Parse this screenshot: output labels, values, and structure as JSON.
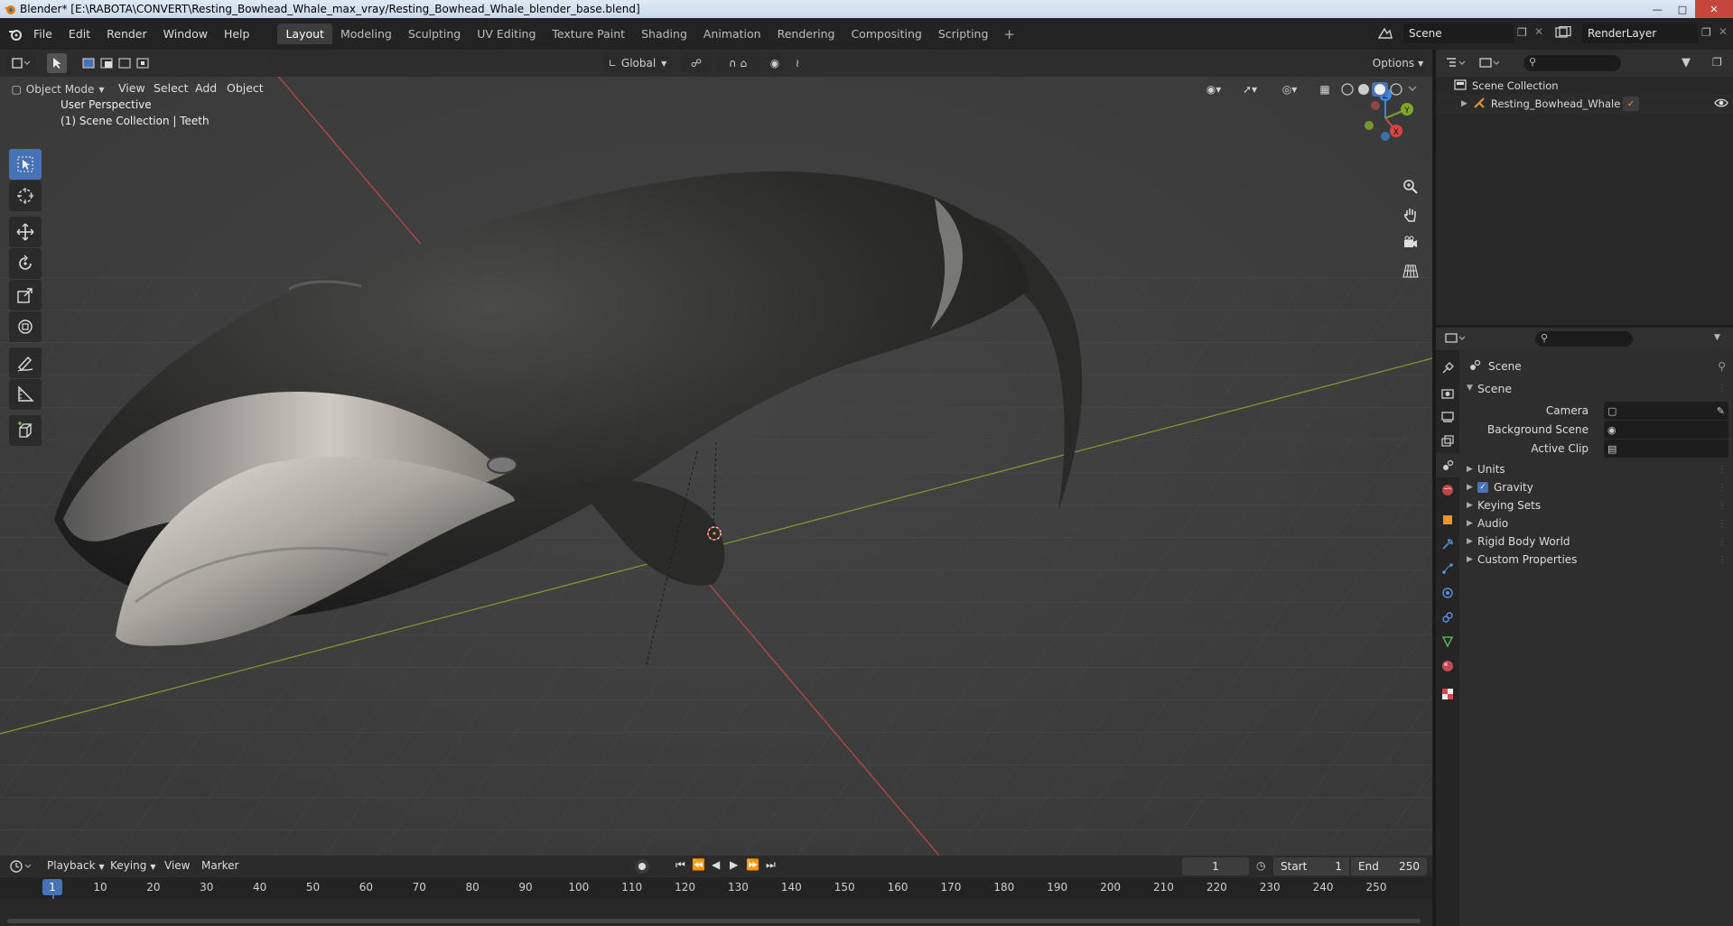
{
  "window": {
    "title": "Blender* [E:\\RABOTA\\CONVERT\\Resting_Bowhead_Whale_max_vray/Resting_Bowhead_Whale_blender_base.blend]"
  },
  "menu": [
    "File",
    "Edit",
    "Render",
    "Window",
    "Help"
  ],
  "workspaces": {
    "active": "Layout",
    "tabs": [
      "Layout",
      "Modeling",
      "Sculpting",
      "UV Editing",
      "Texture Paint",
      "Shading",
      "Animation",
      "Rendering",
      "Compositing",
      "Scripting"
    ],
    "add": "+"
  },
  "scene_selector": {
    "scene": "Scene",
    "view_layer": "RenderLayer"
  },
  "viewport": {
    "mode": "Object Mode",
    "menus": [
      "View",
      "Select",
      "Add",
      "Object"
    ],
    "transform_orientation": "Global",
    "options_label": "Options",
    "info_line1": "User Perspective",
    "info_line2": "(1) Scene Collection | Teeth",
    "gizmo": {
      "x": "X",
      "y": "Y",
      "z": "Z"
    }
  },
  "outliner": {
    "root": "Scene Collection",
    "items": [
      {
        "label": "Resting_Bowhead_Whale"
      }
    ]
  },
  "properties": {
    "context": "Scene",
    "panel_title": "Scene",
    "fields": [
      {
        "label": "Camera",
        "value": ""
      },
      {
        "label": "Background Scene",
        "value": ""
      },
      {
        "label": "Active Clip",
        "value": ""
      }
    ],
    "panels": [
      {
        "label": "Units",
        "checkbox": false
      },
      {
        "label": "Gravity",
        "checkbox": true,
        "checked": true
      },
      {
        "label": "Keying Sets",
        "checkbox": false
      },
      {
        "label": "Audio",
        "checkbox": false
      },
      {
        "label": "Rigid Body World",
        "checkbox": false
      },
      {
        "label": "Custom Properties",
        "checkbox": false
      }
    ]
  },
  "timeline": {
    "menus": [
      "Playback",
      "Keying",
      "View",
      "Marker"
    ],
    "current_frame": "1",
    "start_label": "Start",
    "start": "1",
    "end_label": "End",
    "end": "250",
    "ticks": [
      "1",
      "10",
      "20",
      "30",
      "40",
      "50",
      "60",
      "70",
      "80",
      "90",
      "100",
      "110",
      "120",
      "130",
      "140",
      "150",
      "160",
      "170",
      "180",
      "190",
      "200",
      "210",
      "220",
      "230",
      "240",
      "250"
    ]
  },
  "colors": {
    "accent": "#4772b3",
    "axis_x": "#c94b4b",
    "axis_y": "#7fa82b",
    "axis_z": "#3f86e0"
  }
}
